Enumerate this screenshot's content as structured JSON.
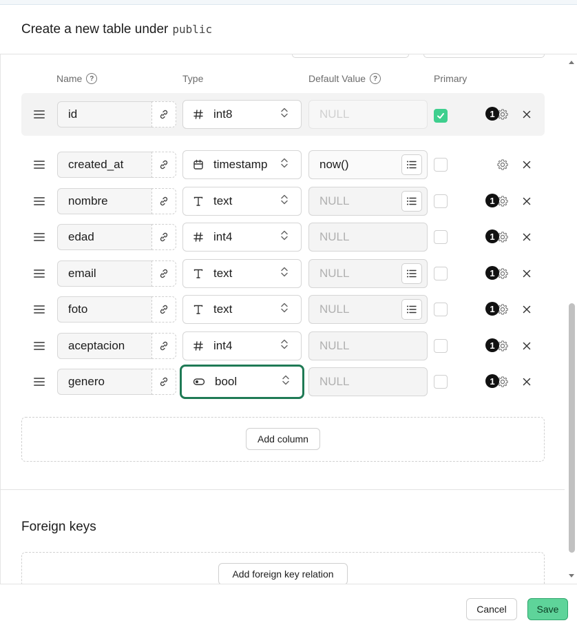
{
  "dialog": {
    "title": "Create a new table under",
    "schema": "public"
  },
  "columns_header": {
    "name": "Name",
    "type": "Type",
    "default_value": "Default Value",
    "primary": "Primary"
  },
  "rows": [
    {
      "name": "id",
      "type": "int8",
      "type_icon": "hash-icon",
      "default": "NULL",
      "default_is_value": false,
      "has_list_button": false,
      "primary": true,
      "badge": "1",
      "has_badge": true
    },
    {
      "name": "created_at",
      "type": "timestamp",
      "type_icon": "calendar-icon",
      "default": "now()",
      "default_is_value": true,
      "has_list_button": true,
      "primary": false,
      "badge": "",
      "has_badge": false
    },
    {
      "name": "nombre",
      "type": "text",
      "type_icon": "text-type-icon",
      "default": "NULL",
      "default_is_value": false,
      "has_list_button": true,
      "primary": false,
      "badge": "1",
      "has_badge": true
    },
    {
      "name": "edad",
      "type": "int4",
      "type_icon": "hash-icon",
      "default": "NULL",
      "default_is_value": false,
      "has_list_button": false,
      "primary": false,
      "badge": "1",
      "has_badge": true
    },
    {
      "name": "email",
      "type": "text",
      "type_icon": "text-type-icon",
      "default": "NULL",
      "default_is_value": false,
      "has_list_button": true,
      "primary": false,
      "badge": "1",
      "has_badge": true
    },
    {
      "name": "foto",
      "type": "text",
      "type_icon": "text-type-icon",
      "default": "NULL",
      "default_is_value": false,
      "has_list_button": true,
      "primary": false,
      "badge": "1",
      "has_badge": true
    },
    {
      "name": "aceptacion",
      "type": "int4",
      "type_icon": "hash-icon",
      "default": "NULL",
      "default_is_value": false,
      "has_list_button": false,
      "primary": false,
      "badge": "1",
      "has_badge": true
    },
    {
      "name": "genero",
      "type": "bool",
      "type_icon": "toggle-icon",
      "default": "NULL",
      "default_is_value": false,
      "has_list_button": false,
      "primary": false,
      "badge": "1",
      "has_badge": true,
      "focused": true
    }
  ],
  "add_column_label": "Add column",
  "foreign_keys": {
    "title": "Foreign keys",
    "add_label": "Add foreign key relation"
  },
  "footer": {
    "cancel_label": "Cancel",
    "save_label": "Save"
  },
  "colors": {
    "accent": "#3ecf8e",
    "focus_border": "#1f7a55",
    "save_bg": "#5ed49a"
  }
}
